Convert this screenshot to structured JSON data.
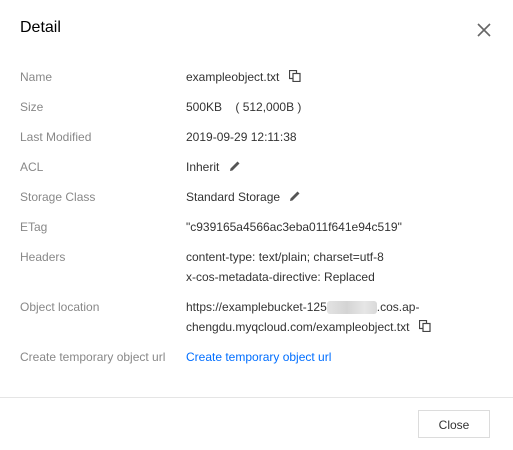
{
  "dialog": {
    "title": "Detail",
    "close_button": "Close"
  },
  "fields": {
    "name": {
      "label": "Name",
      "value": "exampleobject.txt"
    },
    "size": {
      "label": "Size",
      "value": "500KB    ( 512,000B )"
    },
    "last_modified": {
      "label": "Last Modified",
      "value": "2019-09-29 12:11:38"
    },
    "acl": {
      "label": "ACL",
      "value": "Inherit"
    },
    "storage_class": {
      "label": "Storage Class",
      "value": "Standard Storage"
    },
    "etag": {
      "label": "ETag",
      "value": "\"c939165a4566ac3eba011f641e94c519\""
    },
    "headers": {
      "label": "Headers",
      "lines": [
        "content-type: text/plain; charset=utf-8",
        "x-cos-metadata-directive: Replaced"
      ]
    },
    "object_location": {
      "label": "Object location",
      "line1_prefix": "https://examplebucket-125",
      "line1_suffix": ".cos.ap-",
      "line2": "chengdu.myqcloud.com/exampleobject.txt"
    },
    "temp_url": {
      "label": "Create temporary object url",
      "link": "Create temporary object url"
    }
  },
  "icons": {
    "copy": "copy-icon",
    "edit": "pencil-icon",
    "close": "close-icon"
  },
  "colors": {
    "link": "#006eff",
    "label": "#888888",
    "text": "#333333"
  }
}
